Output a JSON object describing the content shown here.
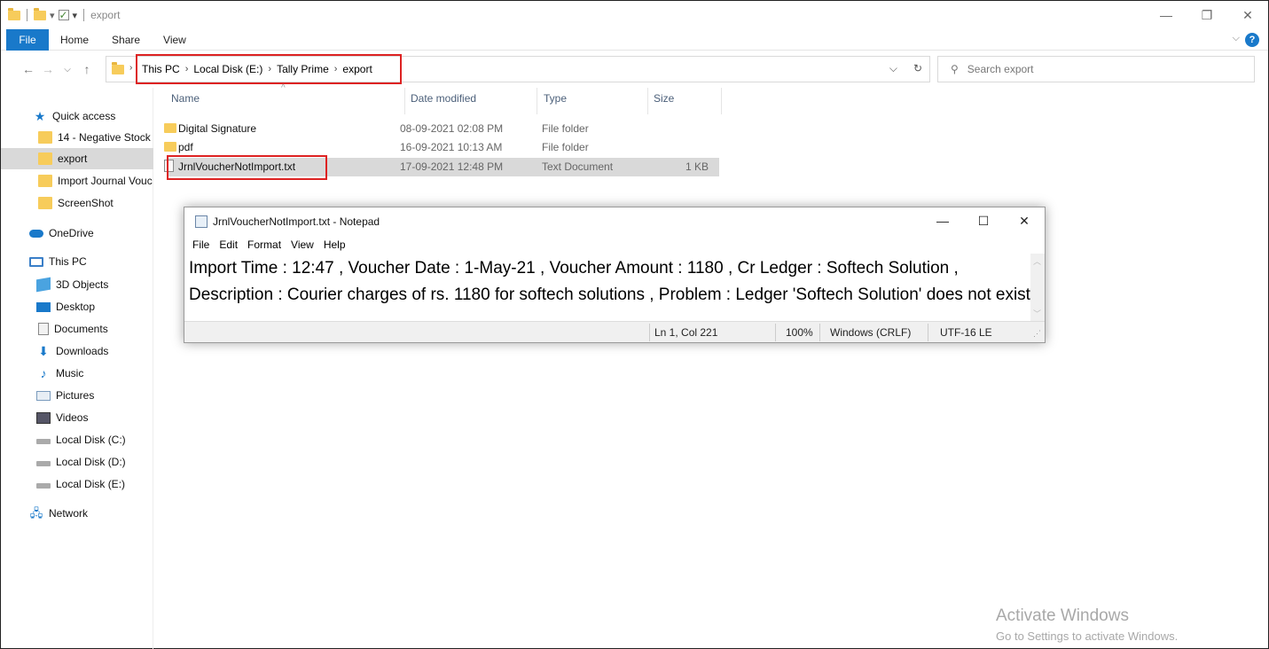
{
  "window": {
    "title": "export"
  },
  "ribbon": {
    "tabs": [
      "File",
      "Home",
      "Share",
      "View"
    ]
  },
  "address": {
    "crumbs": [
      "This PC",
      "Local Disk (E:)",
      "Tally Prime",
      "export"
    ]
  },
  "search": {
    "placeholder": "Search export"
  },
  "sidebar": {
    "items": [
      {
        "label": "Quick access",
        "icon": "star-icon"
      },
      {
        "label": "14 - Negative Stock",
        "icon": "folder-icon"
      },
      {
        "label": "export",
        "icon": "folder-icon"
      },
      {
        "label": "Import Journal Vouc",
        "icon": "folder-icon"
      },
      {
        "label": "ScreenShot",
        "icon": "folder-icon"
      },
      {
        "label": "OneDrive",
        "icon": "cloud-icon"
      },
      {
        "label": "This PC",
        "icon": "computer-icon"
      },
      {
        "label": "3D Objects",
        "icon": "cube-icon"
      },
      {
        "label": "Desktop",
        "icon": "desktop-icon"
      },
      {
        "label": "Documents",
        "icon": "documents-icon"
      },
      {
        "label": "Downloads",
        "icon": "download-icon"
      },
      {
        "label": "Music",
        "icon": "music-icon"
      },
      {
        "label": "Pictures",
        "icon": "pictures-icon"
      },
      {
        "label": "Videos",
        "icon": "videos-icon"
      },
      {
        "label": "Local Disk (C:)",
        "icon": "drive-icon"
      },
      {
        "label": "Local Disk (D:)",
        "icon": "drive-icon"
      },
      {
        "label": "Local Disk (E:)",
        "icon": "drive-icon"
      },
      {
        "label": "Network",
        "icon": "network-icon"
      }
    ]
  },
  "filelist": {
    "columns": [
      "Name",
      "Date modified",
      "Type",
      "Size"
    ],
    "rows": [
      {
        "name": "Digital Signature",
        "date": "08-09-2021 02:08 PM",
        "type": "File folder",
        "size": ""
      },
      {
        "name": "pdf",
        "date": "16-09-2021 10:13 AM",
        "type": "File folder",
        "size": ""
      },
      {
        "name": "JrnlVoucherNotImport.txt",
        "date": "17-09-2021 12:48 PM",
        "type": "Text Document",
        "size": "1 KB"
      }
    ]
  },
  "notepad": {
    "title": "JrnlVoucherNotImport.txt - Notepad",
    "menu": [
      "File",
      "Edit",
      "Format",
      "View",
      "Help"
    ],
    "lines": [
      "Import Time : 12:47 , Voucher Date : 1-May-21 , Voucher Amount : 1180 , Cr Ledger : Softech Solution ,",
      "Description : Courier charges of rs. 1180 for softech solutions , Problem : Ledger 'Softech Solution' does not exist!"
    ],
    "status": {
      "position": "Ln 1, Col 221",
      "zoom": "100%",
      "eol": "Windows (CRLF)",
      "encoding": "UTF-16 LE"
    }
  },
  "watermark": {
    "line1": "Activate Windows",
    "line2": "Go to Settings to activate Windows."
  }
}
